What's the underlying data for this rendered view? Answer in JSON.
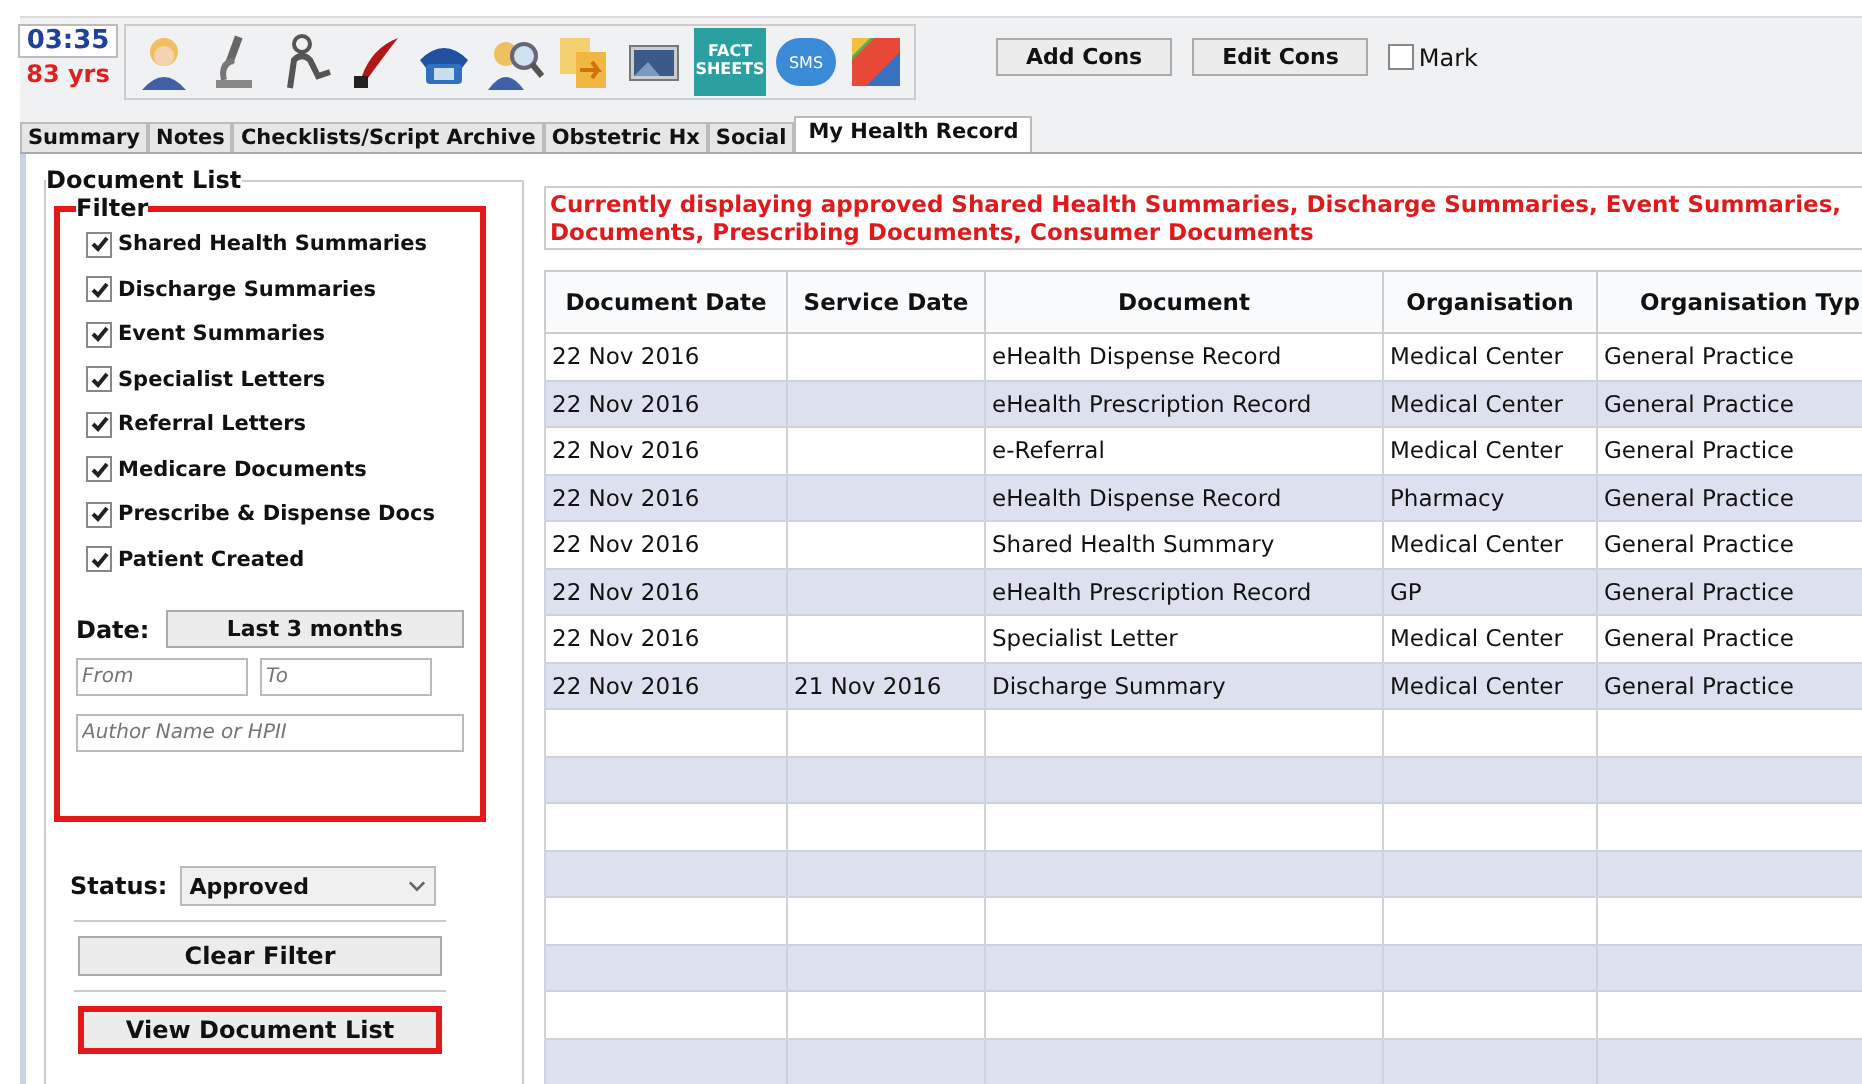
{
  "header": {
    "time": "03:35",
    "age": "83 yrs",
    "fact_sheets_label": "FACT SHEETS",
    "sms_label": "SMS",
    "buttons": [
      "Add Cons",
      "Edit Cons"
    ],
    "mark": {
      "label": "Mark",
      "checked": false
    }
  },
  "tabs": [
    {
      "label": "Summary",
      "selected": false
    },
    {
      "label": "Notes",
      "selected": false
    },
    {
      "label": "Checklists/Script Archive",
      "selected": false
    },
    {
      "label": "Obstetric Hx",
      "selected": false
    },
    {
      "label": "Social",
      "selected": false
    },
    {
      "label": "My Health Record",
      "selected": true
    }
  ],
  "document_list": {
    "title": "Document List",
    "filter": {
      "title": "Filter",
      "items": [
        {
          "label": "Shared Health Summaries",
          "checked": true
        },
        {
          "label": "Discharge Summaries",
          "checked": true
        },
        {
          "label": "Event Summaries",
          "checked": true
        },
        {
          "label": "Specialist Letters",
          "checked": true
        },
        {
          "label": "Referral Letters",
          "checked": true
        },
        {
          "label": "Medicare Documents",
          "checked": true
        },
        {
          "label": "Prescribe & Dispense Docs",
          "checked": true
        },
        {
          "label": "Patient Created",
          "checked": true
        }
      ],
      "date_label": "Date:",
      "date_button": "Last 3 months",
      "from_placeholder": "From",
      "to_placeholder": "To",
      "author_placeholder": "Author Name or HPII"
    },
    "status_label": "Status:",
    "status_value": "Approved",
    "clear_button": "Clear Filter",
    "view_button": "View Document List"
  },
  "notice": [
    "Currently displaying approved Shared Health Summaries, Discharge Summaries, Event Summaries,",
    "Documents, Prescribing Documents, Consumer Documents"
  ],
  "table": {
    "columns": [
      "Document Date",
      "Service Date",
      "Document",
      "Organisation",
      "Organisation Typ"
    ],
    "rows": [
      [
        "22 Nov 2016",
        "",
        "eHealth Dispense Record",
        "Medical Center",
        "General Practice"
      ],
      [
        "22 Nov 2016",
        "",
        "eHealth Prescription Record",
        "Medical Center",
        "General Practice"
      ],
      [
        "22 Nov 2016",
        "",
        "e-Referral",
        "Medical Center",
        "General Practice"
      ],
      [
        "22 Nov 2016",
        "",
        "eHealth Dispense Record",
        "Pharmacy",
        "General Practice"
      ],
      [
        "22 Nov 2016",
        "",
        "Shared Health Summary",
        "Medical Center",
        "General Practice"
      ],
      [
        "22 Nov 2016",
        "",
        "eHealth Prescription Record",
        "GP",
        "General Practice"
      ],
      [
        "22 Nov 2016",
        "",
        "Specialist Letter",
        "Medical Center",
        "General Practice"
      ],
      [
        "22 Nov 2016",
        "21 Nov 2016",
        "Discharge Summary",
        "Medical Center",
        "General Practice"
      ]
    ]
  }
}
